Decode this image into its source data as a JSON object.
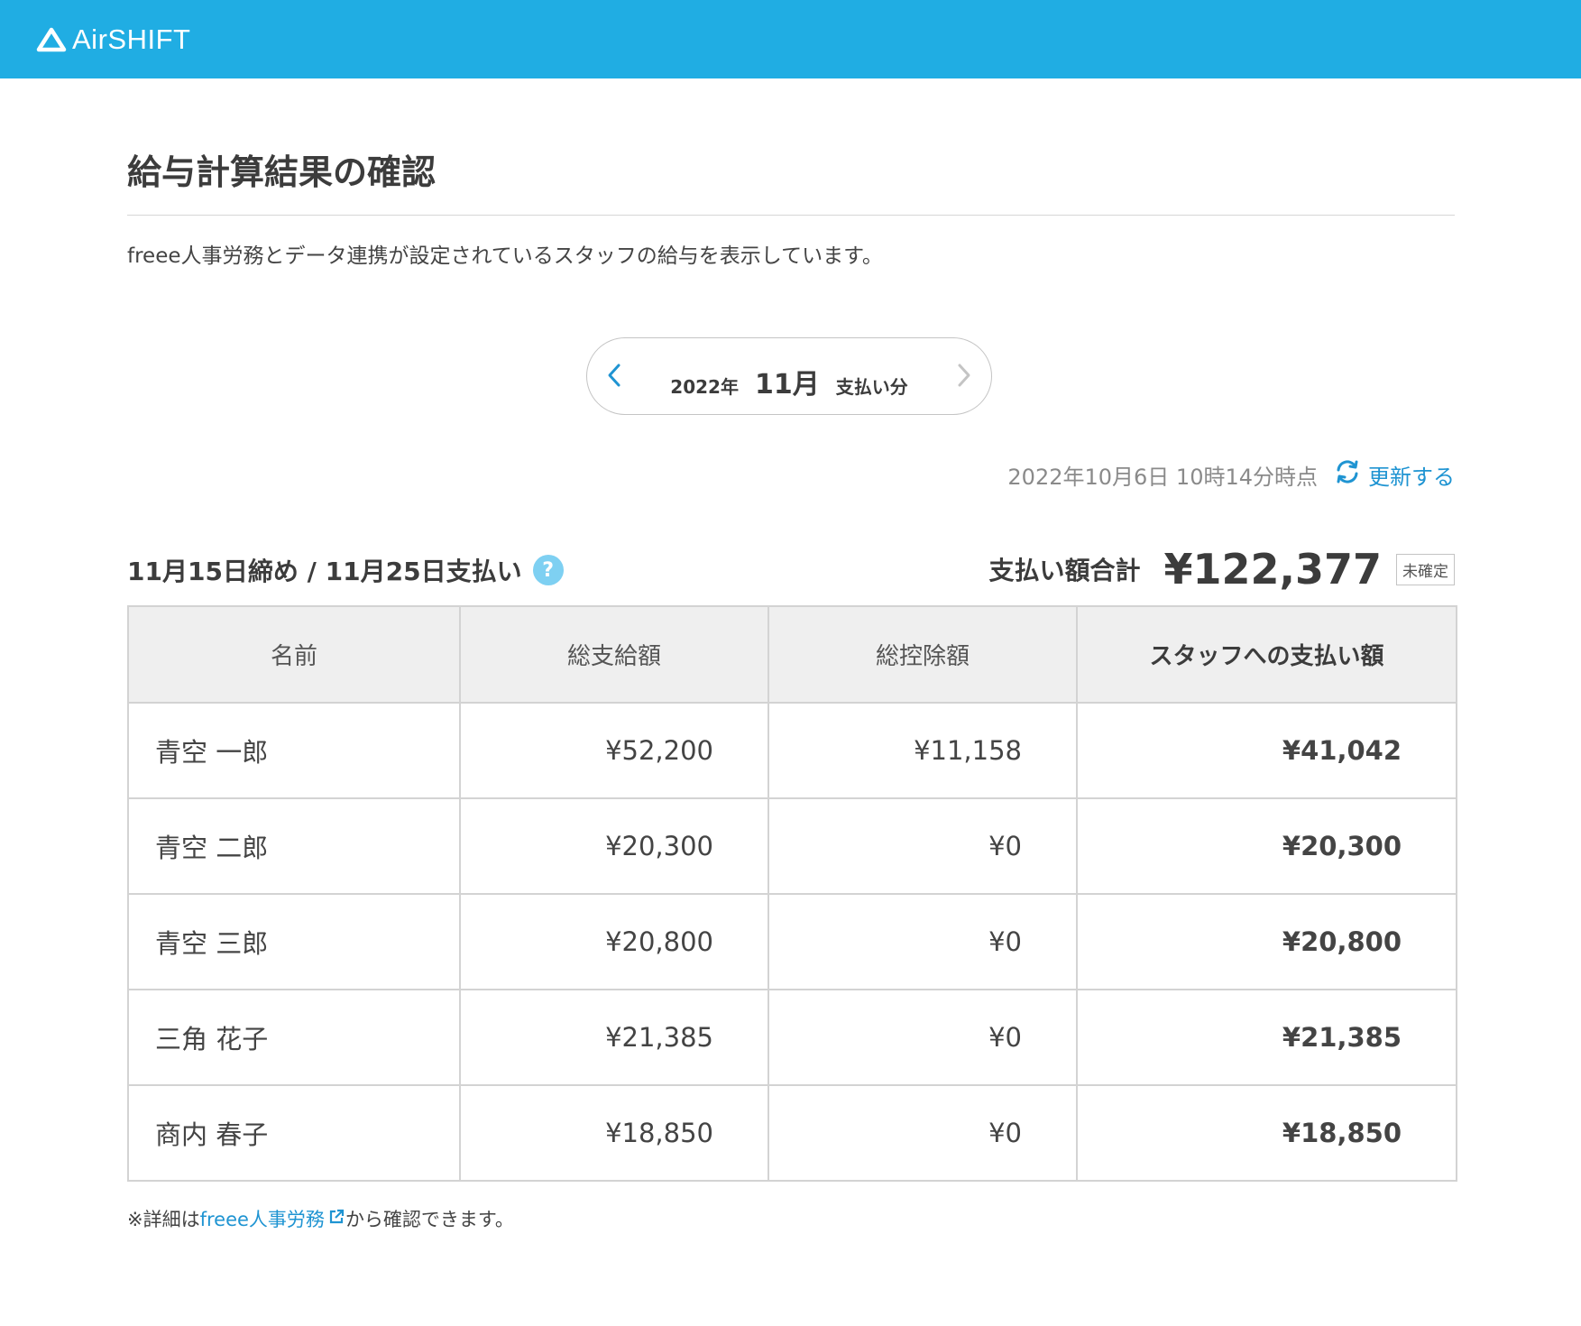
{
  "app": {
    "logo_text": "AirSHIFT"
  },
  "page": {
    "title": "給与計算結果の確認",
    "description": "freee人事労務とデータ連携が設定されているスタッフの給与を表示しています。"
  },
  "month_nav": {
    "year": "2022年",
    "month": "11月",
    "suffix": "支払い分"
  },
  "update": {
    "timestamp": "2022年10月6日 10時14分時点",
    "refresh_label": "更新する"
  },
  "period": {
    "label": "11月15日締め / 11月25日支払い",
    "help": "?"
  },
  "total": {
    "label": "支払い額合計",
    "amount": "¥122,377",
    "status": "未確定"
  },
  "table": {
    "headers": [
      "名前",
      "総支給額",
      "総控除額",
      "スタッフへの支払い額"
    ],
    "rows": [
      {
        "name": "青空 一郎",
        "gross": "¥52,200",
        "deduction": "¥11,158",
        "net": "¥41,042"
      },
      {
        "name": "青空 二郎",
        "gross": "¥20,300",
        "deduction": "¥0",
        "net": "¥20,300"
      },
      {
        "name": "青空 三郎",
        "gross": "¥20,800",
        "deduction": "¥0",
        "net": "¥20,800"
      },
      {
        "name": "三角 花子",
        "gross": "¥21,385",
        "deduction": "¥0",
        "net": "¥21,385"
      },
      {
        "name": "商内 春子",
        "gross": "¥18,850",
        "deduction": "¥0",
        "net": "¥18,850"
      }
    ]
  },
  "footnote": {
    "prefix": "※詳細は",
    "link": "freee人事労務",
    "suffix": "から確認できます。"
  },
  "colors": {
    "header_bg": "#20ade3",
    "link": "#1f94d2",
    "help_icon": "#7ed0f2"
  },
  "icons": {
    "logo": "triangle-logo-icon",
    "prev": "chevron-left-icon",
    "next": "chevron-right-icon",
    "refresh": "refresh-icon",
    "help": "question-circle-icon",
    "external": "external-link-icon"
  }
}
